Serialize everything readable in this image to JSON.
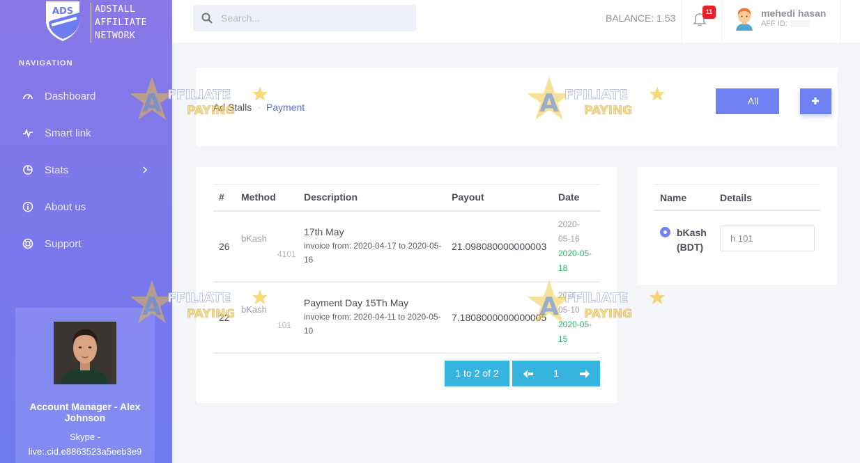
{
  "brand": {
    "logo_badge": "ADS",
    "logo_lines": [
      "ADSTALL",
      "AFFILIATE",
      "NETWORK"
    ]
  },
  "sidebar": {
    "heading": "NAVIGATION",
    "items": [
      {
        "label": "Dashboard",
        "icon": "gauge-icon"
      },
      {
        "label": "Smart link",
        "icon": "pulse-icon"
      },
      {
        "label": "Stats",
        "icon": "pie-chart-icon",
        "has_submenu": true
      },
      {
        "label": "About us",
        "icon": "info-icon"
      },
      {
        "label": "Support",
        "icon": "lifebuoy-icon"
      }
    ],
    "manager": {
      "name": "Account Manager - Alex Johnson",
      "skype_label": "Skype -",
      "skype_id": "live:.cid.e8863523a5eeb3e9"
    }
  },
  "topbar": {
    "search_placeholder": "Search...",
    "balance": "BALANCE: 1.53",
    "notification_count": "11",
    "user_name": "mehedi hasan",
    "aff_id_label": "AFF ID:"
  },
  "breadcrumb": {
    "root": "Ad Stalls",
    "current": "Payment"
  },
  "actions": {
    "filter_label": "All"
  },
  "payments": {
    "columns": [
      "#",
      "Method",
      "Description",
      "Payout",
      "Date"
    ],
    "rows": [
      {
        "id": "26",
        "method": "bKash",
        "method_number": "4101",
        "title": "17th May",
        "invoice": "invoice from: 2020-04-17 to 2020-05-16",
        "payout": "21.098080000000003",
        "date_1": "2020-05-16",
        "date_2": "2020-05-18"
      },
      {
        "id": "22",
        "method": "bKash",
        "method_number": "101",
        "title": "Payment Day 15Th May",
        "invoice": "invoice from: 2020-04-11 to 2020-05-10",
        "payout": "7.1808000000000005",
        "date_1": "2020-05-10",
        "date_2": "2020-05-15"
      }
    ],
    "pagination": {
      "info": "1 to 2 of 2",
      "current_page": "1"
    }
  },
  "payment_details": {
    "columns": [
      "Name",
      "Details"
    ],
    "method_name": "bKash (BDT)",
    "details_value": "h 101"
  },
  "watermark": {
    "letter": "A",
    "line1": "FFILIATE",
    "line2": "PAYING"
  },
  "colors": {
    "accent": "#6f80f2",
    "pagination": "#36b4e0",
    "date_green": "#2cb26f",
    "badge_red": "#e8202a"
  }
}
